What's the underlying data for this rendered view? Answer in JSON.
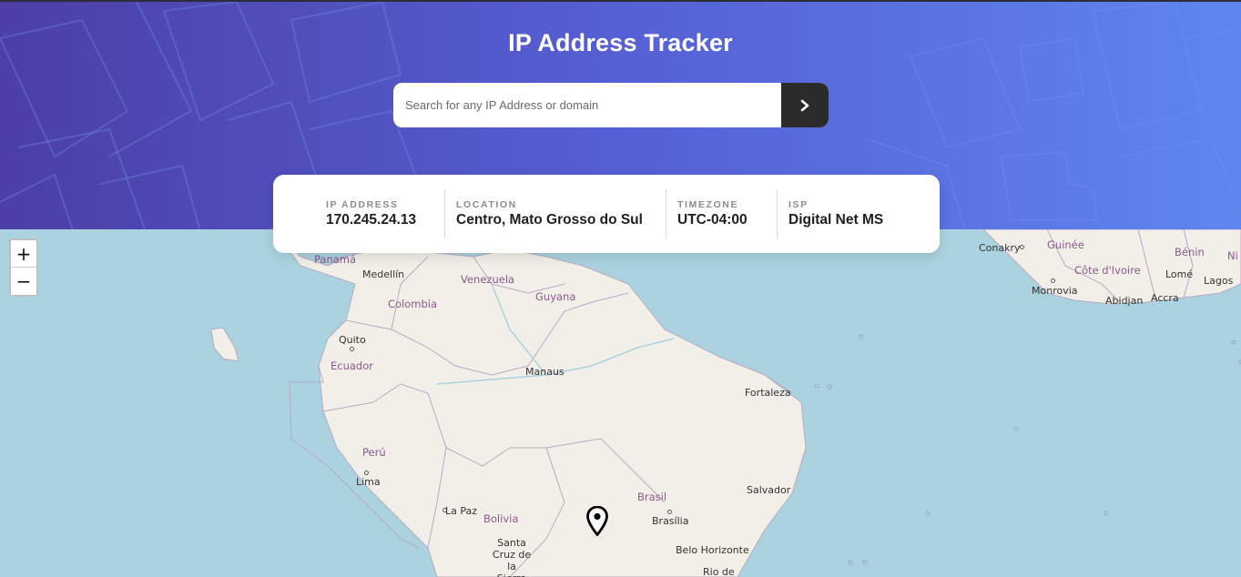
{
  "header": {
    "title": "IP Address Tracker"
  },
  "search": {
    "placeholder": "Search for any IP Address or domain",
    "value": "",
    "submit_icon": "chevron-right-icon"
  },
  "info": {
    "ip_label": "IP ADDRESS",
    "ip_value": "170.245.24.13",
    "location_label": "LOCATION",
    "location_value": "Centro, Mato Grosso do Sul",
    "timezone_label": "TIMEZONE",
    "timezone_value": "UTC-04:00",
    "isp_label": "ISP",
    "isp_value": "Digital Net MS"
  },
  "map": {
    "zoom_in": "+",
    "zoom_out": "−",
    "marker_icon": "map-pin-icon",
    "cities": {
      "conakry": "Conakry",
      "monrovia": "Monrovia",
      "abidjan": "Abidjan",
      "accra": "Accra",
      "lome": "Lomé",
      "lagos": "Lagos",
      "medellin": "Medellín",
      "quito": "Quito",
      "lima": "Lima",
      "la_paz": "La Paz",
      "santa_cruz": "Santa Cruz de la Sierra",
      "manaus": "Manaus",
      "fortaleza": "Fortaleza",
      "salvador": "Salvador",
      "brasilia": "Brasília",
      "belo_horizonte": "Belo Horizonte",
      "rio": "Rio de"
    },
    "countries": {
      "panama": "Panamá",
      "venezuela": "Venezuela",
      "colombia": "Colombia",
      "guyana": "Guyana",
      "ecuador": "Ecuador",
      "peru": "Perú",
      "bolivia": "Bolivia",
      "brasil": "Brasil",
      "guinee": "Guinée",
      "cote": "Côte d'Ivoire",
      "benin": "Bénin",
      "nigeria": "Ni"
    }
  }
}
